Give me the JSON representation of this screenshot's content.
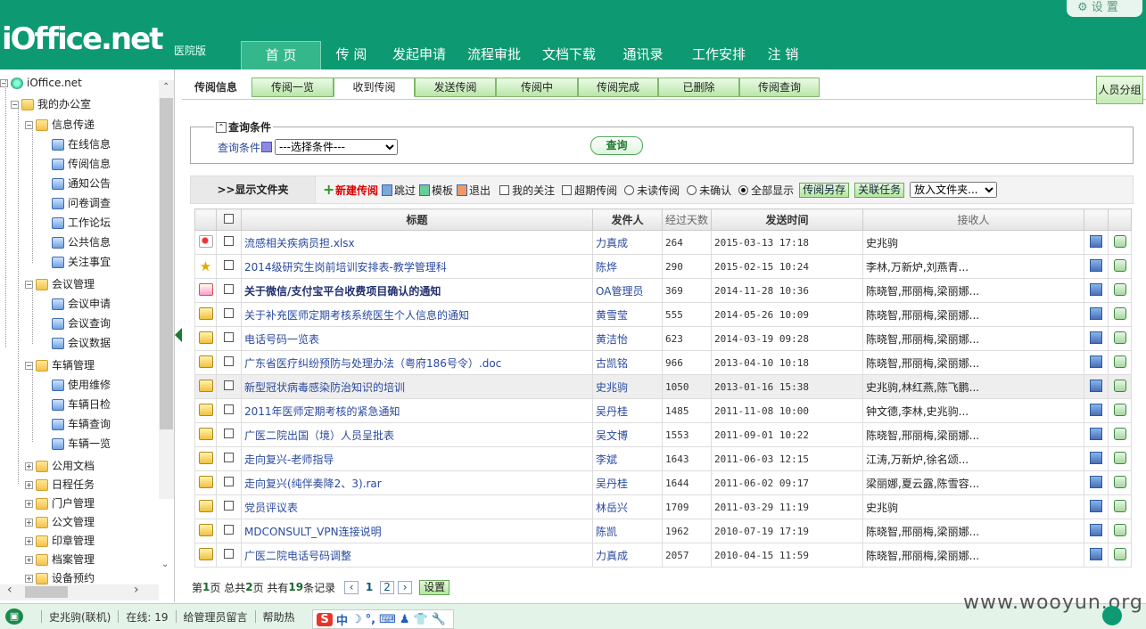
{
  "header": {
    "logo": "iOffice.net",
    "edition": "医院版",
    "settings_label": "设 置",
    "nav": [
      "首 页",
      "传 阅",
      "发起申请",
      "流程审批",
      "文档下载",
      "通讯录",
      "工作安排",
      "注 销"
    ],
    "active_nav": 0
  },
  "tree": {
    "root": "iOffice.net",
    "my_office": "我的办公室",
    "groups": [
      {
        "label": "信息传递",
        "items": [
          "在线信息",
          "传阅信息",
          "通知公告",
          "问卷调查",
          "工作论坛",
          "公共信息",
          "关注事宜"
        ]
      },
      {
        "label": "会议管理",
        "items": [
          "会议申请",
          "会议查询",
          "会议数据"
        ]
      },
      {
        "label": "车辆管理",
        "items": [
          "使用维修",
          "车辆日检",
          "车辆查询",
          "车辆一览"
        ]
      }
    ],
    "collapsed": [
      "公用文档",
      "日程任务",
      "门户管理",
      "公文管理",
      "印章管理",
      "档案管理",
      "设备预约"
    ]
  },
  "tabs": {
    "label": "传阅信息",
    "items": [
      "传阅一览",
      "收到传阅",
      "发送传阅",
      "传阅中",
      "传阅完成",
      "已删除",
      "传阅查询"
    ],
    "active": 1,
    "group_button": "人员分组"
  },
  "query": {
    "title": "查询条件",
    "cond_label": "查询条件",
    "select_value": "---选择条件---",
    "button": "查询"
  },
  "toolbar": {
    "show_folder": ">>显示文件夹",
    "new": "新建传阅",
    "skip": "跳过",
    "template": "模板",
    "exit": "退出",
    "my_follow": "我的关注",
    "overdue": "超期传阅",
    "unread": "未读传阅",
    "unconfirmed": "未确认",
    "show_all": "全部显示",
    "save_as": "传阅另存",
    "link_task": "关联任务",
    "put_folder": "放入文件夹..."
  },
  "table": {
    "headers": {
      "title": "标题",
      "sender": "发件人",
      "days": "经过天数",
      "time": "发送时间",
      "recv": "接收人"
    },
    "rows": [
      {
        "icon": "pin",
        "title": "流感相关疾病员担.xlsx",
        "sender": "力真成",
        "days": "264",
        "time": "2015-03-13 17:18",
        "recv": "史兆驹",
        "bold": false
      },
      {
        "icon": "star",
        "title": "2014级研究生岗前培训安排表-教学管理科",
        "sender": "陈烨",
        "days": "290",
        "time": "2015-02-15 10:24",
        "recv": "李林,万新炉,刘燕青...",
        "bold": false
      },
      {
        "icon": "red",
        "title": "关于微信/支付宝平台收费项目确认的通知",
        "sender": "OA管理员",
        "days": "369",
        "time": "2014-11-28 10:36",
        "recv": "陈晓智,邢丽梅,梁丽娜...",
        "bold": true
      },
      {
        "icon": "env",
        "title": "关于补充医师定期考核系统医生个人信息的通知",
        "sender": "黄雪莹",
        "days": "555",
        "time": "2014-05-26 10:09",
        "recv": "陈晓智,邢丽梅,梁丽娜...",
        "bold": false
      },
      {
        "icon": "env",
        "title": "电话号码一览表",
        "sender": "黄洁怡",
        "days": "623",
        "time": "2014-03-19 09:28",
        "recv": "陈晓智,邢丽梅,梁丽娜...",
        "bold": false
      },
      {
        "icon": "env",
        "title": "广东省医疗纠纷预防与处理办法（粤府186号令）.doc",
        "sender": "古凯铭",
        "days": "966",
        "time": "2013-04-10 10:18",
        "recv": "陈晓智,邢丽梅,梁丽娜...",
        "bold": false
      },
      {
        "icon": "env",
        "title": "新型冠状病毒感染防治知识的培训",
        "sender": "史兆驹",
        "days": "1050",
        "time": "2013-01-16 15:38",
        "recv": "史兆驹,林红燕,陈飞鹏...",
        "bold": false
      },
      {
        "icon": "env",
        "title": "2011年医师定期考核的紧急通知",
        "sender": "吴丹桂",
        "days": "1485",
        "time": "2011-11-08 10:00",
        "recv": "钟文德,李林,史兆驹...",
        "bold": false
      },
      {
        "icon": "env",
        "title": "广医二院出国（境）人员呈批表",
        "sender": "吴文博",
        "days": "1553",
        "time": "2011-09-01 10:22",
        "recv": "陈晓智,邢丽梅,梁丽娜...",
        "bold": false
      },
      {
        "icon": "env",
        "title": "走向复兴-老师指导",
        "sender": "李斌",
        "days": "1643",
        "time": "2011-06-03 12:15",
        "recv": "江涛,万新炉,徐名颂...",
        "bold": false
      },
      {
        "icon": "env",
        "title": "走向复兴(纯伴奏降2、3).rar",
        "sender": "吴丹桂",
        "days": "1644",
        "time": "2011-06-02 09:17",
        "recv": "梁丽娜,夏云露,陈雪容...",
        "bold": false
      },
      {
        "icon": "env",
        "title": "党员评议表",
        "sender": "林岳兴",
        "days": "1709",
        "time": "2011-03-29 11:19",
        "recv": "史兆驹",
        "bold": false
      },
      {
        "icon": "env",
        "title": "MDCONSULT_VPN连接说明",
        "sender": "陈凯",
        "days": "1962",
        "time": "2010-07-19 17:19",
        "recv": "陈晓智,邢丽梅,梁丽娜...",
        "bold": false
      },
      {
        "icon": "env",
        "title": "广医二院电话号码调整",
        "sender": "力真成",
        "days": "2057",
        "time": "2010-04-15 11:59",
        "recv": "陈晓智,邢丽梅,梁丽娜...",
        "bold": false
      }
    ],
    "highlight_row": 6
  },
  "pager": {
    "p1": "第",
    "cur": "1",
    "p2": "页 总共",
    "total_pages": "2",
    "p3": "页 共有",
    "count": "19",
    "p4": "条记录",
    "pages": [
      "1",
      "2"
    ],
    "settings": "设置"
  },
  "status": {
    "user": "史兆驹(联机)",
    "online": "在线: 19",
    "msg": "给管理员留言",
    "help": "帮助热",
    "ime": [
      "S",
      "中",
      "☽",
      "°,",
      "⌨",
      "♟",
      "👕",
      "🔧"
    ]
  },
  "watermark": "www.wooyun.org"
}
